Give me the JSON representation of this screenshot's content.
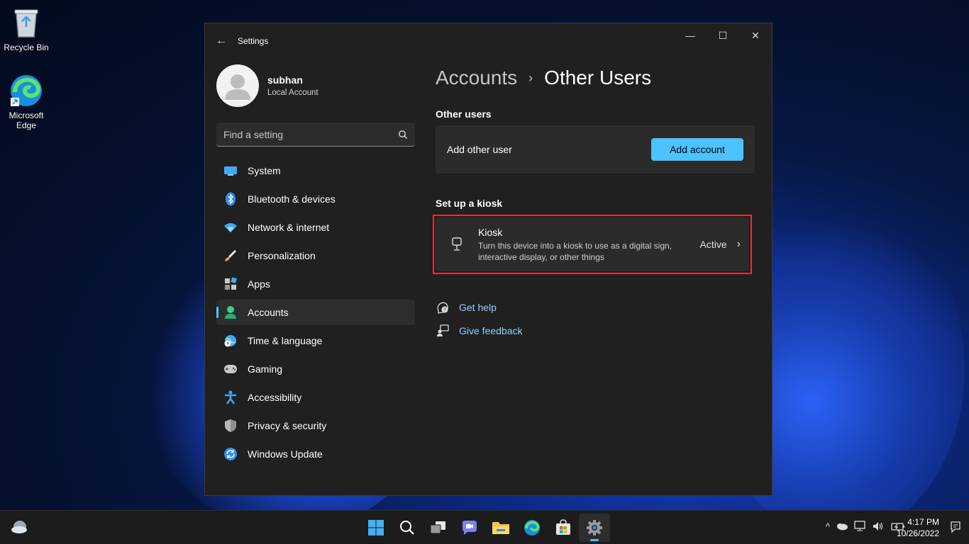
{
  "desktop": {
    "icons": [
      {
        "label": "Recycle Bin",
        "icon": "recycle-bin-icon"
      },
      {
        "label": "Microsoft Edge",
        "icon": "edge-icon"
      }
    ]
  },
  "window": {
    "title": "Settings",
    "caption": {
      "minimize": "—",
      "maximize": "☐",
      "close": "✕"
    }
  },
  "profile": {
    "name": "subhan",
    "subtitle": "Local Account"
  },
  "search": {
    "placeholder": "Find a setting"
  },
  "nav": {
    "items": [
      {
        "label": "System",
        "icon": "system-icon"
      },
      {
        "label": "Bluetooth & devices",
        "icon": "bluetooth-icon"
      },
      {
        "label": "Network & internet",
        "icon": "wifi-icon"
      },
      {
        "label": "Personalization",
        "icon": "brush-icon"
      },
      {
        "label": "Apps",
        "icon": "apps-icon"
      },
      {
        "label": "Accounts",
        "icon": "accounts-icon",
        "active": true
      },
      {
        "label": "Time & language",
        "icon": "globe-clock-icon"
      },
      {
        "label": "Gaming",
        "icon": "gamepad-icon"
      },
      {
        "label": "Accessibility",
        "icon": "accessibility-icon"
      },
      {
        "label": "Privacy & security",
        "icon": "shield-icon"
      },
      {
        "label": "Windows Update",
        "icon": "update-icon"
      }
    ]
  },
  "main": {
    "breadcrumb": {
      "parent": "Accounts",
      "separator": "›",
      "current": "Other Users"
    },
    "other_users": {
      "heading": "Other users",
      "row_label": "Add other user",
      "button_label": "Add account"
    },
    "kiosk": {
      "heading": "Set up a kiosk",
      "title": "Kiosk",
      "description": "Turn this device into a kiosk to use as a digital sign, interactive display, or other things",
      "status": "Active"
    },
    "links": [
      {
        "label": "Get help",
        "icon": "help-icon"
      },
      {
        "label": "Give feedback",
        "icon": "feedback-icon"
      }
    ]
  },
  "taskbar": {
    "apps": [
      "start-icon",
      "search-icon",
      "task-view-icon",
      "chat-icon",
      "file-explorer-icon",
      "edge-icon",
      "store-icon",
      "settings-icon"
    ],
    "tray": {
      "chevron": "^"
    },
    "clock": {
      "time": "4:17 PM",
      "date": "10/26/2022"
    }
  },
  "colors": {
    "accent": "#4cc2ff",
    "highlight": "#e1323c",
    "window_bg": "#202020",
    "card_bg": "#2b2b2b"
  }
}
